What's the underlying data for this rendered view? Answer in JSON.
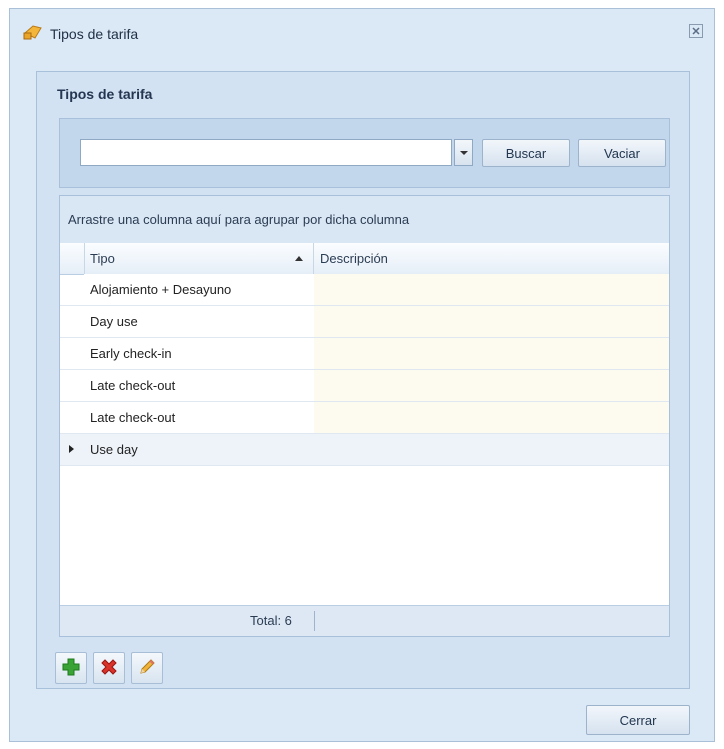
{
  "window": {
    "title": "Tipos de tarifa"
  },
  "group": {
    "title": "Tipos de tarifa"
  },
  "search": {
    "value": "",
    "buscar_label": "Buscar",
    "vaciar_label": "Vaciar"
  },
  "grid": {
    "group_hint": "Arrastre una columna aquí para agrupar por dicha columna",
    "columns": [
      "Tipo",
      "Descripción"
    ],
    "rows": [
      {
        "tipo": "Alojamiento + Desayuno",
        "descripcion": ""
      },
      {
        "tipo": "Day use",
        "descripcion": ""
      },
      {
        "tipo": "Early check-in",
        "descripcion": ""
      },
      {
        "tipo": "Late check-out",
        "descripcion": ""
      },
      {
        "tipo": "Late check-out",
        "descripcion": ""
      },
      {
        "tipo": "Use day",
        "descripcion": ""
      }
    ],
    "total_label": "Total: 6"
  },
  "toolbar": {
    "add_icon": "plus-icon",
    "delete_icon": "delete-icon",
    "edit_icon": "pencil-icon"
  },
  "footer": {
    "cerrar_label": "Cerrar"
  },
  "colors": {
    "add": "#3aa335",
    "delete": "#d8322a",
    "edit": "#f0b43c"
  }
}
